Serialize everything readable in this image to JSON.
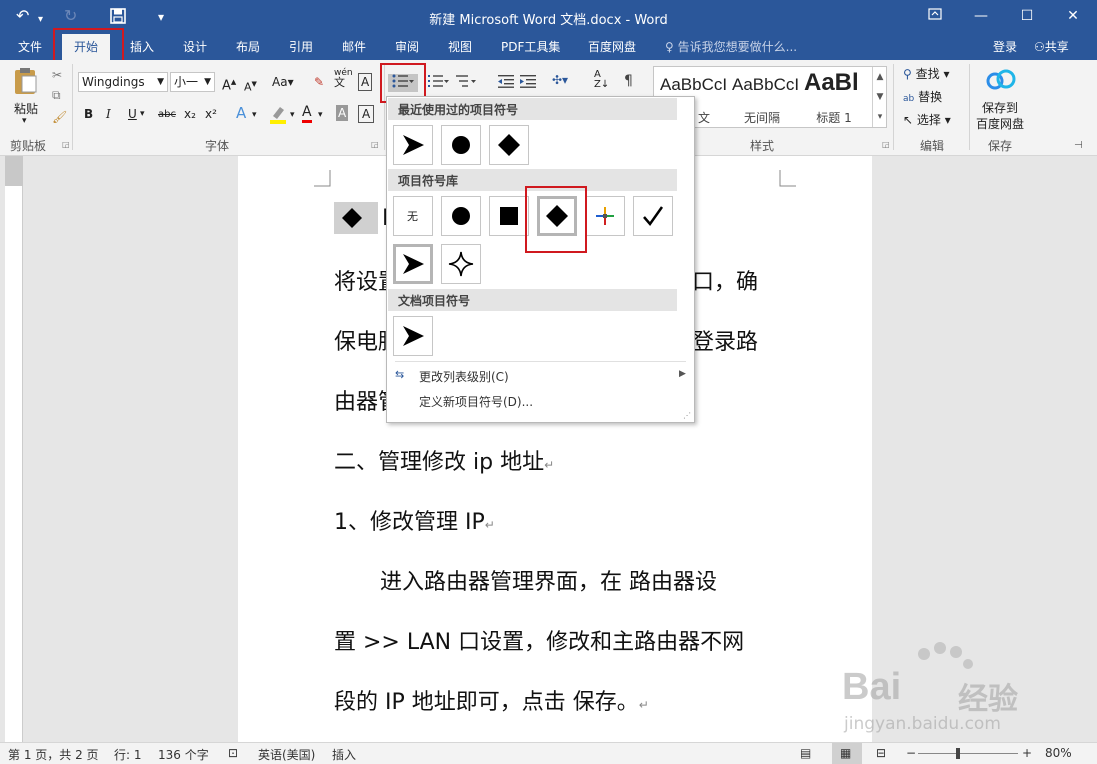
{
  "titlebar": {
    "title": "新建 Microsoft Word 文档.docx - Word",
    "undo_icon": "↶",
    "redo_icon": "↻",
    "save_icon": "save-icon"
  },
  "tabs": [
    {
      "label": "文件"
    },
    {
      "label": "开始"
    },
    {
      "label": "插入"
    },
    {
      "label": "设计"
    },
    {
      "label": "布局"
    },
    {
      "label": "引用"
    },
    {
      "label": "邮件"
    },
    {
      "label": "审阅"
    },
    {
      "label": "视图"
    },
    {
      "label": "PDF工具集"
    },
    {
      "label": "百度网盘"
    }
  ],
  "tellme": "告诉我您想要做什么...",
  "login": "登录",
  "share": "共享",
  "ribbon": {
    "paste": "粘贴",
    "clipboard": "剪贴板",
    "font_name": "Wingdings",
    "font_size": "小一",
    "font_group": "字体",
    "styles_group": "样式",
    "styles": [
      {
        "preview": "AaBbCcI",
        "name": "文"
      },
      {
        "preview": "AaBbCcI",
        "name": "无间隔"
      },
      {
        "preview": "AaBl",
        "name": "标题 1"
      }
    ],
    "find": "查找",
    "replace": "替换",
    "select": "选择",
    "edit_group": "编辑",
    "save_baidu_1": "保存到",
    "save_baidu_2": "百度网盘",
    "save_group": "保存",
    "wen": "文",
    "bold": "B",
    "italic": "I",
    "underline": "U",
    "strike": "abc",
    "sub": "x₂",
    "sup": "x²",
    "font_inc": "A",
    "font_dec": "A",
    "change_case": "Aa",
    "text_effect": "A",
    "font_color": "A",
    "char_shade": "A",
    "phonetic_1": "wén",
    "phonetic_2": "文",
    "border_char": "A",
    "sort": "A↓Z",
    "char_shade_box": "A"
  },
  "dropdown": {
    "recent_header": "最近使用过的项目符号",
    "library_header": "项目符号库",
    "doc_header": "文档项目符号",
    "none_label": "无",
    "change_level": "更改列表级别(C)",
    "define_new": "定义新项目符号(D)..."
  },
  "document": {
    "lines": [
      "将设置",
      "口，确",
      "保电脑",
      "登录路",
      "由器管",
      "二、管理修改 ip 地址",
      "1、修改管理 IP",
      "进入路由器管理界面，在 路由器设",
      "置 >> LAN 口设置，修改和主路由器不网",
      "段的 IP 地址即可，点击 保存。"
    ],
    "first_line_letter": "B"
  },
  "status": {
    "page": "第 1 页，共 2 页",
    "line": "行: 1",
    "words": "136 个字",
    "lang": "英语(美国)",
    "mode": "插入",
    "zoom": "80%"
  },
  "watermark": {
    "brand": "Bai",
    "brand2": "经验",
    "url": "jingyan.baidu.com"
  }
}
